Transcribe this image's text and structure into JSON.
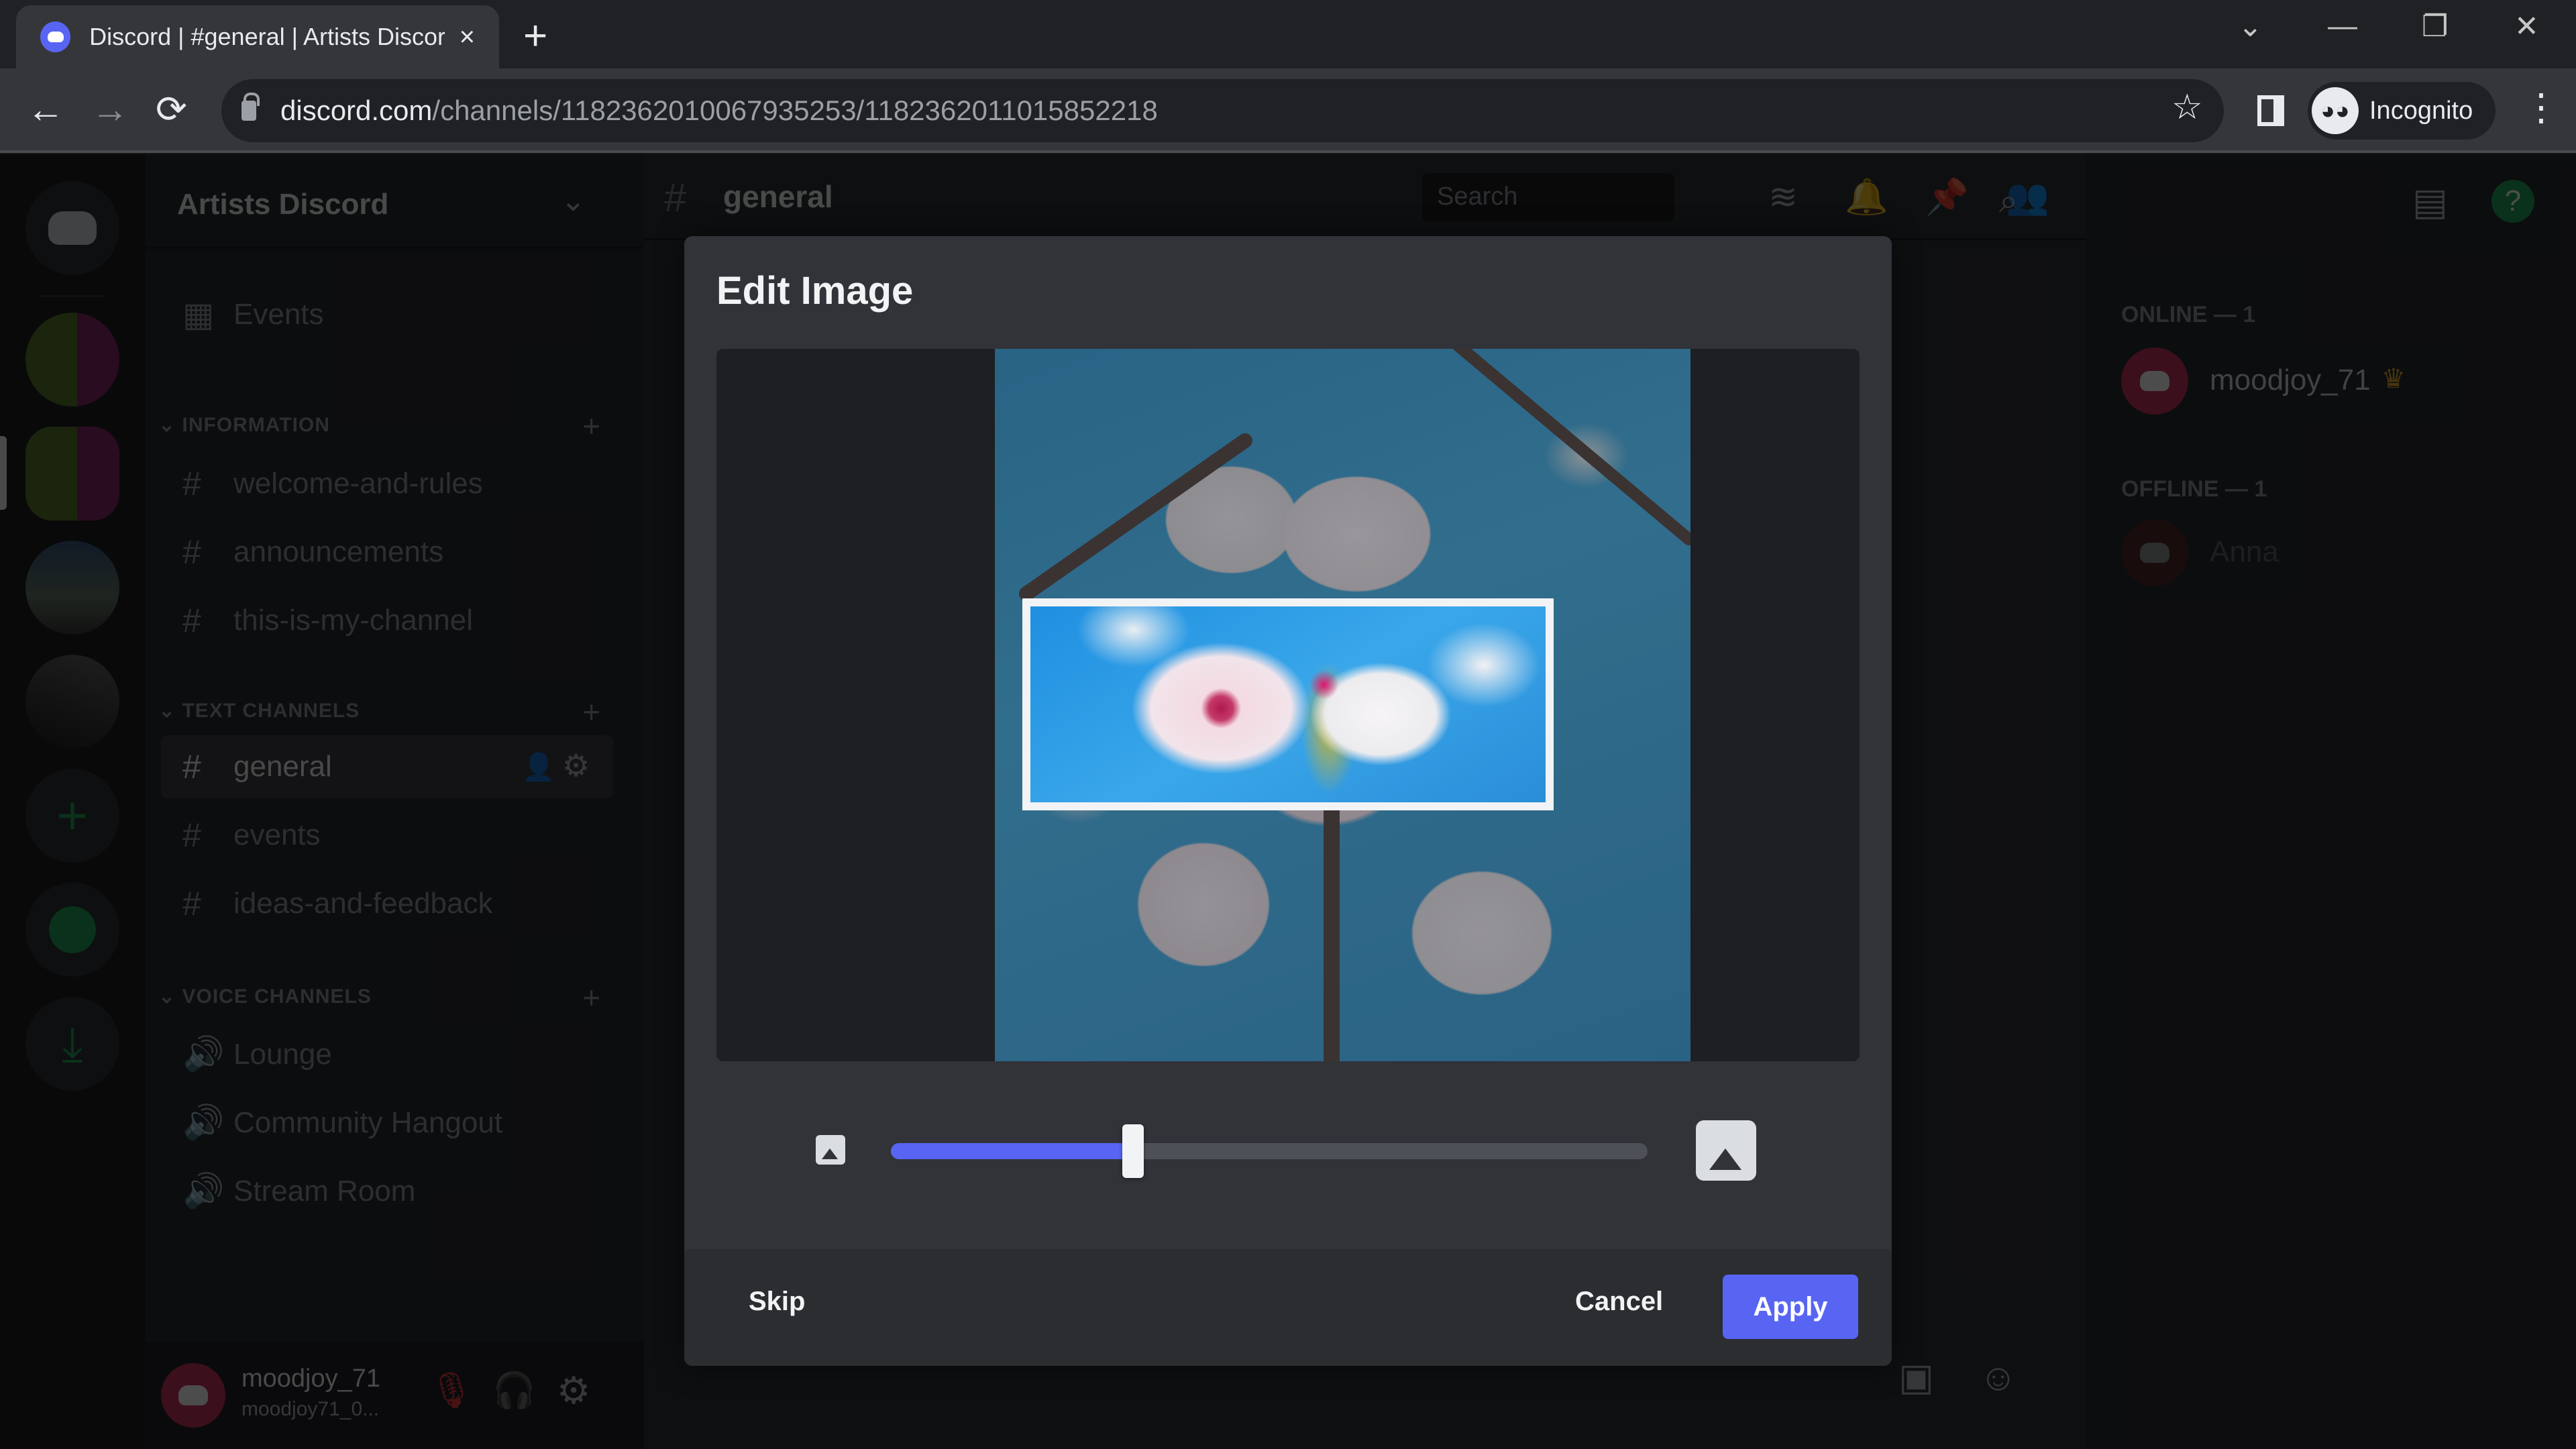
{
  "browser": {
    "tab_title": "Discord | #general | Artists Discord",
    "tab_close": "×",
    "new_tab": "+",
    "url_host": "discord.com",
    "url_path": "/channels/1182362010067935253/1182362011015852218",
    "profile_label": "Incognito",
    "icons": {
      "back": "←",
      "forward": "→",
      "reload": "⟳",
      "star": "☆",
      "menu": "⋮",
      "tab_search": "⌄",
      "minimize": "—",
      "restore": "❐",
      "close": "✕",
      "incognito": "🕶"
    }
  },
  "server_list": {
    "items": [
      "home",
      "Artists server",
      "Artists Discord",
      "landscape server",
      "dark server",
      "add server",
      "explore",
      "download"
    ]
  },
  "channel_sidebar": {
    "server_name": "Artists Discord",
    "events_label": "Events",
    "categories": [
      {
        "name": "INFORMATION",
        "channels": [
          "welcome-and-rules",
          "announcements",
          "this-is-my-channel"
        ]
      },
      {
        "name": "TEXT CHANNELS",
        "channels": [
          "general",
          "events",
          "ideas-and-feedback"
        ]
      },
      {
        "name": "VOICE CHANNELS",
        "channels": [
          "Lounge",
          "Community Hangout",
          "Stream Room"
        ]
      }
    ],
    "selected_channel": "general",
    "user": {
      "name": "moodjoy_71",
      "status": "moodjoy71_0..."
    }
  },
  "channel_header": {
    "hash": "#",
    "name": "general",
    "search_placeholder": "Search"
  },
  "members": {
    "online_header": "ONLINE — 1",
    "offline_header": "OFFLINE — 1",
    "online": [
      {
        "name": "moodjoy_71",
        "badge": "♛"
      }
    ],
    "offline": [
      {
        "name": "Anna"
      }
    ]
  },
  "modal": {
    "title": "Edit Image",
    "zoom_slider_value": 0.32,
    "skip_label": "Skip",
    "cancel_label": "Cancel",
    "apply_label": "Apply",
    "accent_color": "#5865f2"
  }
}
